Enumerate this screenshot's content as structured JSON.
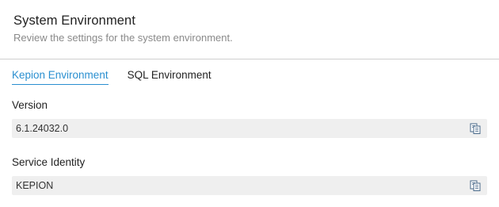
{
  "header": {
    "title": "System Environment",
    "subtitle": "Review the settings for the system environment."
  },
  "tabs": [
    {
      "label": "Kepion Environment",
      "active": true
    },
    {
      "label": "SQL Environment",
      "active": false
    }
  ],
  "fields": [
    {
      "label": "Version",
      "value": "6.1.24032.0",
      "action_icon": "copy-icon"
    },
    {
      "label": "Service Identity",
      "value": "KEPION",
      "action_icon": "copy-icon"
    }
  ],
  "colors": {
    "accent": "#2a8fd0",
    "field_background": "#efefef",
    "icon": "#4a6a8a"
  }
}
